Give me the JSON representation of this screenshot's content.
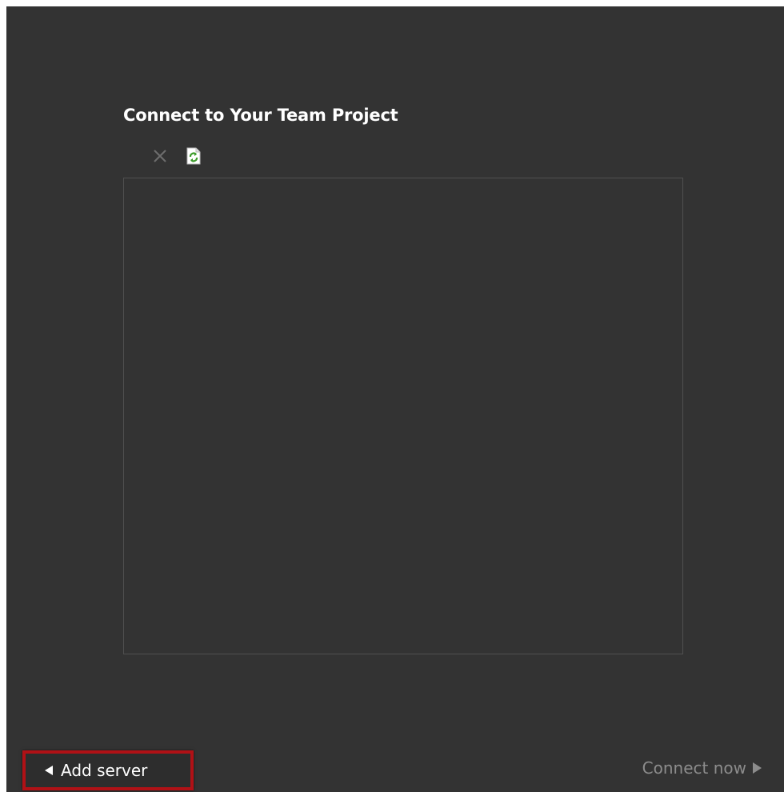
{
  "dialog": {
    "title": "Connect to Your Team Project"
  },
  "toolbar": {
    "remove_icon": "close-icon",
    "refresh_icon": "refresh-icon"
  },
  "project_list": {
    "items": []
  },
  "footer": {
    "add_server_label": "Add server",
    "connect_now_label": "Connect now"
  },
  "colors": {
    "background": "#333333",
    "highlight": "#b01116",
    "disabled_text": "#8c8c8c",
    "refresh_green": "#3c9b2a"
  }
}
